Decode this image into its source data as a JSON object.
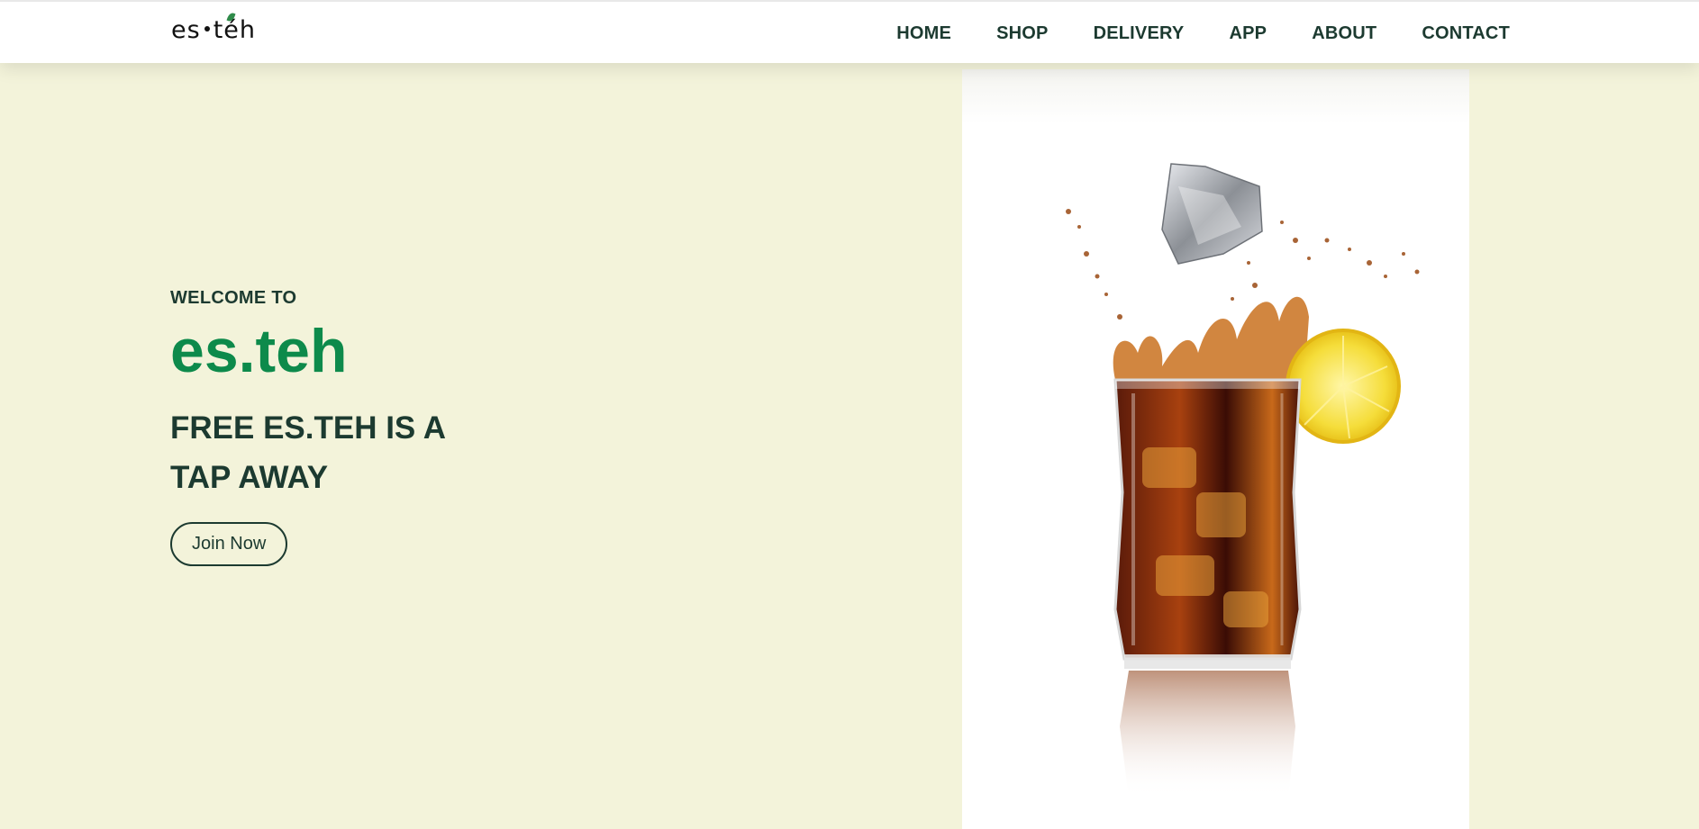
{
  "header": {
    "logo_text_left": "es",
    "logo_text_right": "téh",
    "nav": [
      {
        "label": "HOME"
      },
      {
        "label": "SHOP"
      },
      {
        "label": "DELIVERY"
      },
      {
        "label": "APP"
      },
      {
        "label": "ABOUT"
      },
      {
        "label": "CONTACT"
      }
    ]
  },
  "hero": {
    "welcome": "WELCOME TO",
    "brand": "es.teh",
    "tagline": "FREE ES.TEH IS A TAP AWAY",
    "cta_label": "Join Now"
  },
  "colors": {
    "background": "#f3f3da",
    "brand_green": "#0d8a4b",
    "text_dark": "#1c3a30",
    "navbar": "#ffffff"
  },
  "icons": {
    "logo_leaf": "leaf-icon",
    "hero_image": "iced-tea-glass-with-lemon-image"
  }
}
